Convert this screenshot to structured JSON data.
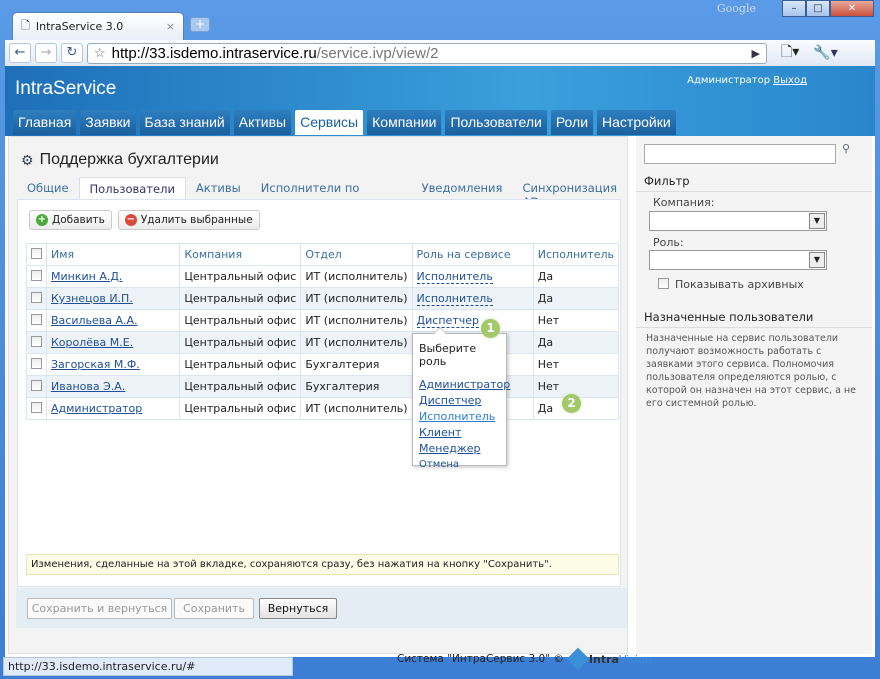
{
  "browser": {
    "tab_title": "IntraService 3.0",
    "brand": "Google",
    "url_host": "http://33.isdemo.intraservice.ru",
    "url_path": "/service.ivp/view/2",
    "status_url": "http://33.isdemo.intraservice.ru/#"
  },
  "header": {
    "logo": "IntraService",
    "user": "Администратор",
    "logout": "Выход"
  },
  "nav": [
    "Главная",
    "Заявки",
    "База знаний",
    "Активы",
    "Сервисы",
    "Компании",
    "Пользователи",
    "Роли",
    "Настройки"
  ],
  "page": {
    "title": "Поддержка бухгалтерии",
    "tabs": [
      "Общие",
      "Пользователи",
      "Активы",
      "Исполнители по категориям",
      "Уведомления",
      "Синхронизация AD"
    ]
  },
  "toolbar": {
    "add": "Добавить",
    "delete": "Удалить выбранные"
  },
  "table": {
    "headers": [
      "Имя",
      "Компания",
      "Отдел",
      "Роль на сервисе",
      "Исполнитель"
    ],
    "rows": [
      [
        "Минкин А.Д.",
        "Центральный офис",
        "ИТ (исполнитель)",
        "Исполнитель",
        "Да"
      ],
      [
        "Кузнецов И.П.",
        "Центральный офис",
        "ИТ (исполнитель)",
        "Исполнитель",
        "Да"
      ],
      [
        "Васильева А.А.",
        "Центральный офис",
        "ИТ (исполнитель)",
        "Диспетчер",
        "Нет"
      ],
      [
        "Королёва М.Е.",
        "Центральный офис",
        "ИТ (исполнитель)",
        "",
        "Да"
      ],
      [
        "Загорская М.Ф.",
        "Центральный офис",
        "Бухгалтерия",
        "",
        "Нет"
      ],
      [
        "Иванова Э.А.",
        "Центральный офис",
        "Бухгалтерия",
        "",
        "Нет"
      ],
      [
        "Администратор",
        "Центральный офис",
        "ИТ (исполнитель)",
        "",
        "Да"
      ]
    ]
  },
  "popup": {
    "title": "Выберите роль",
    "roles": [
      "Администратор",
      "Диспетчер",
      "Исполнитель",
      "Клиент",
      "Менеджер"
    ],
    "cancel": "Отмена"
  },
  "badges": [
    "1",
    "2"
  ],
  "info": "Изменения, сделанные на этой вкладке, сохраняются сразу, без нажатия на кнопку \"Сохранить\".",
  "actions": {
    "save_return": "Сохранить и вернуться",
    "save": "Сохранить",
    "back": "Вернуться"
  },
  "footer": {
    "text": "Система \"ИнтраСервис 3.0\" ©",
    "logo": "IntraVision software development"
  },
  "sidebar": {
    "filter": "Фильтр",
    "company": "Компания:",
    "role": "Роль:",
    "archived": "Показывать архивных",
    "assigned_title": "Назначенные пользователи",
    "assigned_text": "Назначенные на сервис пользователи получают возможность работать с заявками этого сервиса. Полномочия пользователя определяются ролью, с которой он назначен на этот сервис, а не его системной ролью."
  }
}
